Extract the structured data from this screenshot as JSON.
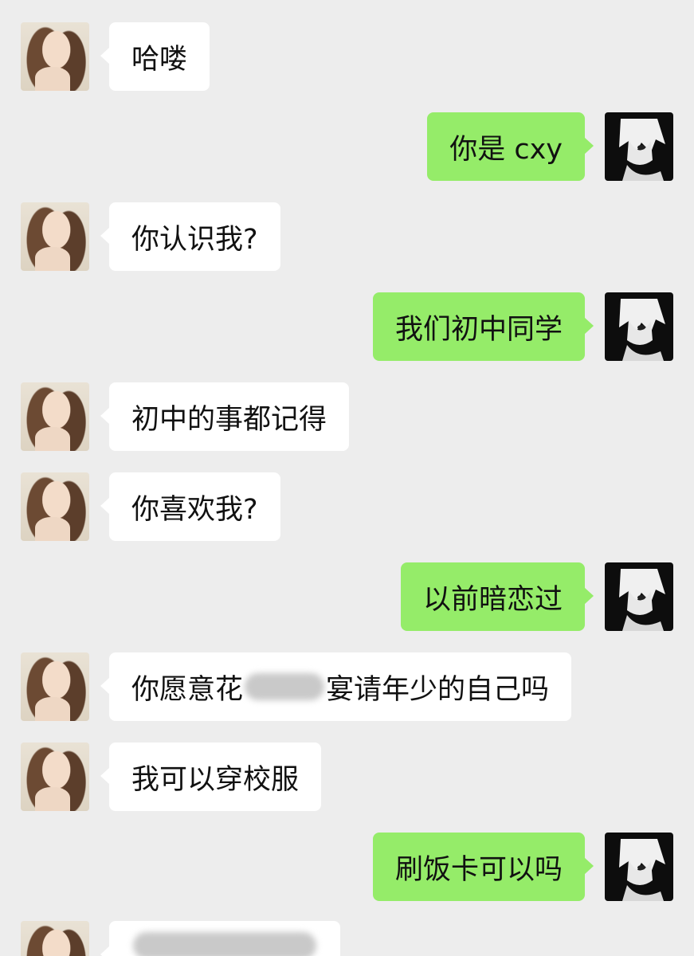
{
  "chat": {
    "messages": [
      {
        "side": "in",
        "text": "哈喽"
      },
      {
        "side": "out",
        "text": "你是 cxy"
      },
      {
        "side": "in",
        "text": "你认识我?"
      },
      {
        "side": "out",
        "text": "我们初中同学"
      },
      {
        "side": "in",
        "text": "初中的事都记得"
      },
      {
        "side": "in",
        "text": "你喜欢我?"
      },
      {
        "side": "out",
        "text": "以前暗恋过"
      },
      {
        "side": "in",
        "text_before": "你愿意花",
        "text_after": "宴请年少的自己吗"
      },
      {
        "side": "in",
        "text": "我可以穿校服"
      },
      {
        "side": "out",
        "text": "刷饭卡可以吗"
      },
      {
        "side": "in",
        "text": ""
      }
    ]
  },
  "avatars": {
    "contact": "girl-photo-avatar",
    "self": "anime-sketch-avatar"
  },
  "colors": {
    "background": "#ededed",
    "incoming_bubble": "#ffffff",
    "outgoing_bubble": "#95ec69",
    "text": "#111111"
  }
}
